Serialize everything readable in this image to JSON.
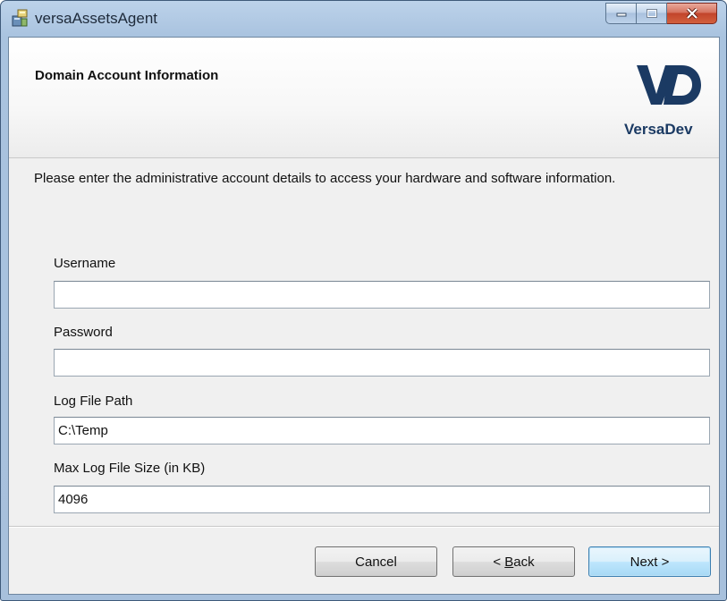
{
  "window": {
    "title": "versaAssetsAgent",
    "caption_buttons": {
      "minimize_icon": "minimize-icon",
      "maximize_icon": "maximize-icon",
      "close_icon": "close-icon"
    }
  },
  "banner": {
    "title": "Domain Account Information",
    "logo_mark": "VD",
    "logo_text": "VersaDev",
    "logo_color": "#1b3a63"
  },
  "description": "Please enter the administrative account details to access your hardware and software information.",
  "form": {
    "username": {
      "label": "Username",
      "value": ""
    },
    "password": {
      "label": "Password",
      "value": ""
    },
    "log_file_path": {
      "label": "Log File Path",
      "value": "C:\\Temp"
    },
    "max_log_size": {
      "label": "Max Log File Size (in KB)",
      "value": "4096"
    }
  },
  "buttons": {
    "cancel": "Cancel",
    "back_prefix": "< ",
    "back_mnemonic": "B",
    "back_rest": "ack",
    "next": "Next >"
  }
}
